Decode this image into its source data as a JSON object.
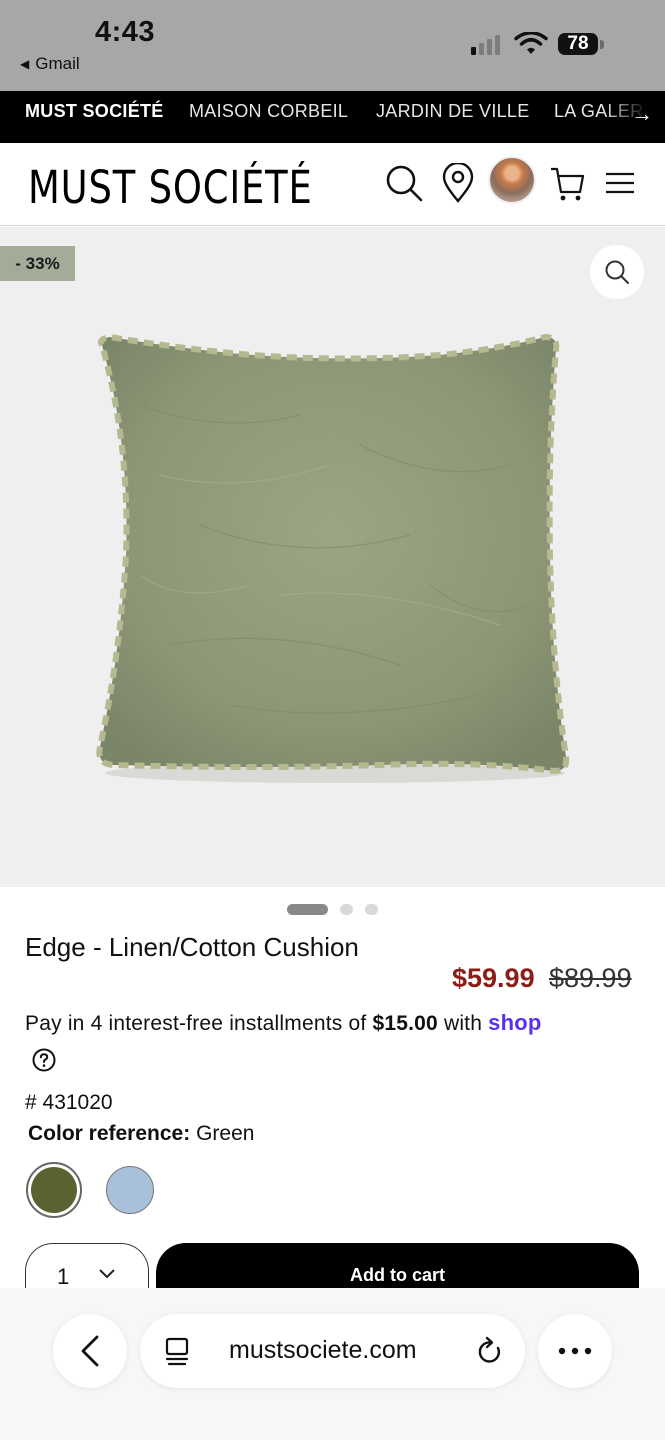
{
  "status_bar": {
    "time": "4:43",
    "back_app": "Gmail",
    "battery": "78"
  },
  "brand_nav": {
    "items": [
      "MUST SOCIÉTÉ",
      "MAISON CORBEIL",
      "JARDIN DE VILLE",
      "LA GALERIE"
    ],
    "active_index": 0
  },
  "header": {
    "logo": "MUST SOCIÉTÉ",
    "icons": [
      "search-icon",
      "location-pin-icon",
      "avatar",
      "cart-icon",
      "menu-icon"
    ]
  },
  "gallery": {
    "discount_badge": "- 33%",
    "image_count": 3,
    "active_image": 0
  },
  "product": {
    "title": "Edge - Linen/Cotton Cushion",
    "sale_price": "$59.99",
    "original_price": "$89.99",
    "installments_prefix": "Pay in 4 interest-free installments of",
    "installments_amount": "$15.00",
    "installments_with": "with",
    "installments_brand": "shop",
    "sku": "# 431020",
    "color_label": "Color reference:",
    "color_value": "Green",
    "swatches": [
      {
        "name": "Green",
        "color": "#5b6232",
        "selected": true
      },
      {
        "name": "Blue",
        "color": "#a9c0da",
        "selected": false
      }
    ],
    "quantity": "1",
    "add_to_cart": "Add to cart"
  },
  "browser": {
    "url": "mustsociete.com"
  },
  "colors": {
    "sale": "#8b1e17",
    "shop_pay": "#5a31f4",
    "badge": "#a4ab98",
    "cushion": "#8f9a7a"
  }
}
